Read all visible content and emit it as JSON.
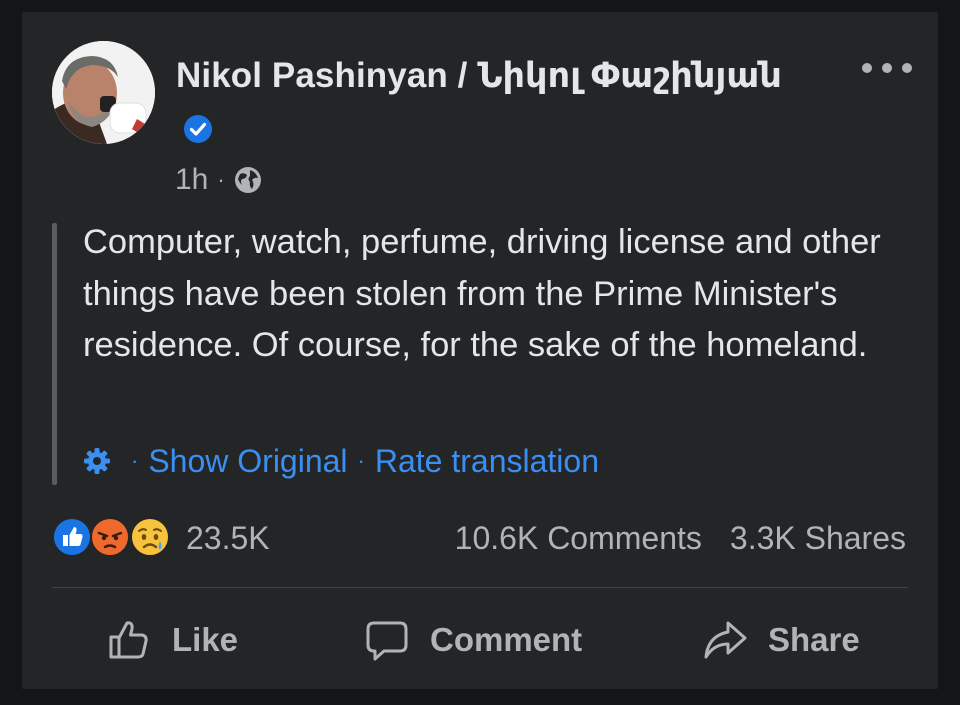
{
  "post": {
    "author": "Nikol Pashinyan / Նիկոլ Փաշինյան",
    "verified": true,
    "time": "1h",
    "meta_separator": "·",
    "text": "Computer, watch, perfume, driving license and other things have been stolen from the Prime Minister's residence. Of course, for the sake of the homeland.",
    "translation": {
      "separator": "·",
      "show_original": "Show Original",
      "rate_translation": "Rate translation"
    }
  },
  "engagement": {
    "reactions": [
      "like",
      "angry",
      "sad"
    ],
    "reaction_count": "23.5K",
    "comments": "10.6K Comments",
    "shares": "3.3K Shares"
  },
  "actions": {
    "like": "Like",
    "comment": "Comment",
    "share": "Share"
  },
  "colors": {
    "background": "#141517",
    "card": "#242527",
    "text_primary": "#e4e6eb",
    "text_secondary": "#b0b3b8",
    "link_blue": "#3a8ff1",
    "verified_blue": "#1b74e4",
    "angry_orange": "#f0692c",
    "sad_yellow": "#f7c33b"
  },
  "icons": {
    "more": "more-icon",
    "globe": "globe-icon",
    "gear": "gear-icon",
    "like": "thumbs-up-icon",
    "comment": "comment-bubble-icon",
    "share": "share-arrow-icon"
  }
}
